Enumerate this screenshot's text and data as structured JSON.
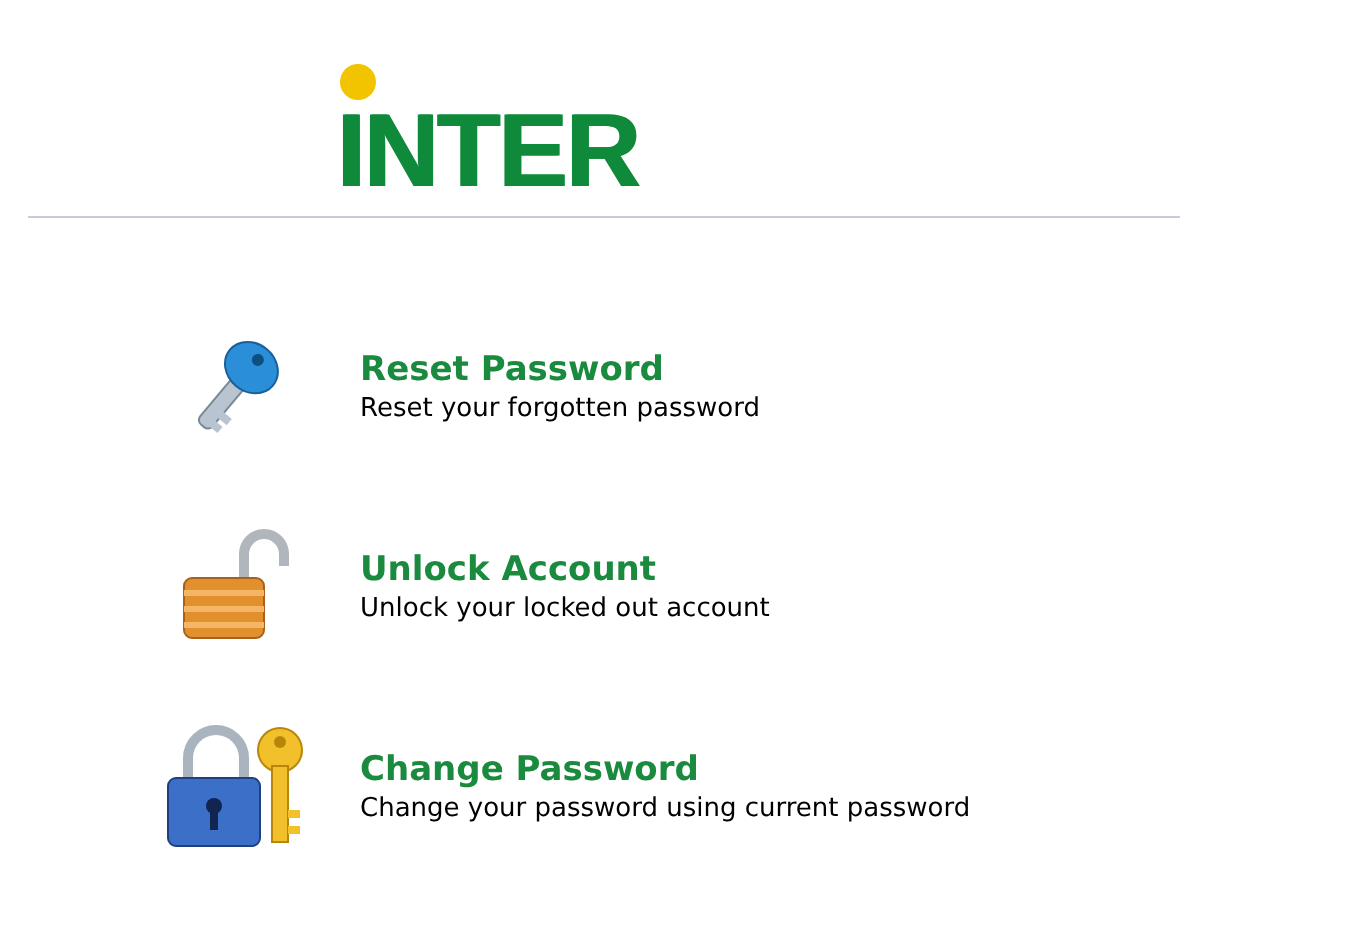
{
  "logo": {
    "text": "INTER"
  },
  "options": [
    {
      "kind": "key",
      "title": "Reset Password",
      "description": "Reset your forgotten password"
    },
    {
      "kind": "unlock",
      "title": "Unlock Account",
      "description": "Unlock your locked out account"
    },
    {
      "kind": "lockkey",
      "title": "Change Password",
      "description": "Change your password using current password"
    }
  ]
}
